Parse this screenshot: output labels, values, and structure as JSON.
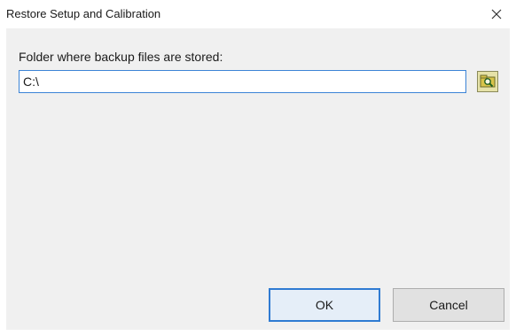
{
  "window": {
    "title": "Restore Setup and Calibration",
    "close_glyph": "close-icon"
  },
  "form": {
    "folder_label": "Folder where backup files are stored:",
    "folder_path": "C:\\",
    "browse_icon": "browse-folder-icon"
  },
  "buttons": {
    "ok_label": "OK",
    "cancel_label": "Cancel"
  },
  "colors": {
    "focus_border": "#3c84d6",
    "dialog_background": "#f0f0f0",
    "browse_button": "#e6e2a8"
  }
}
